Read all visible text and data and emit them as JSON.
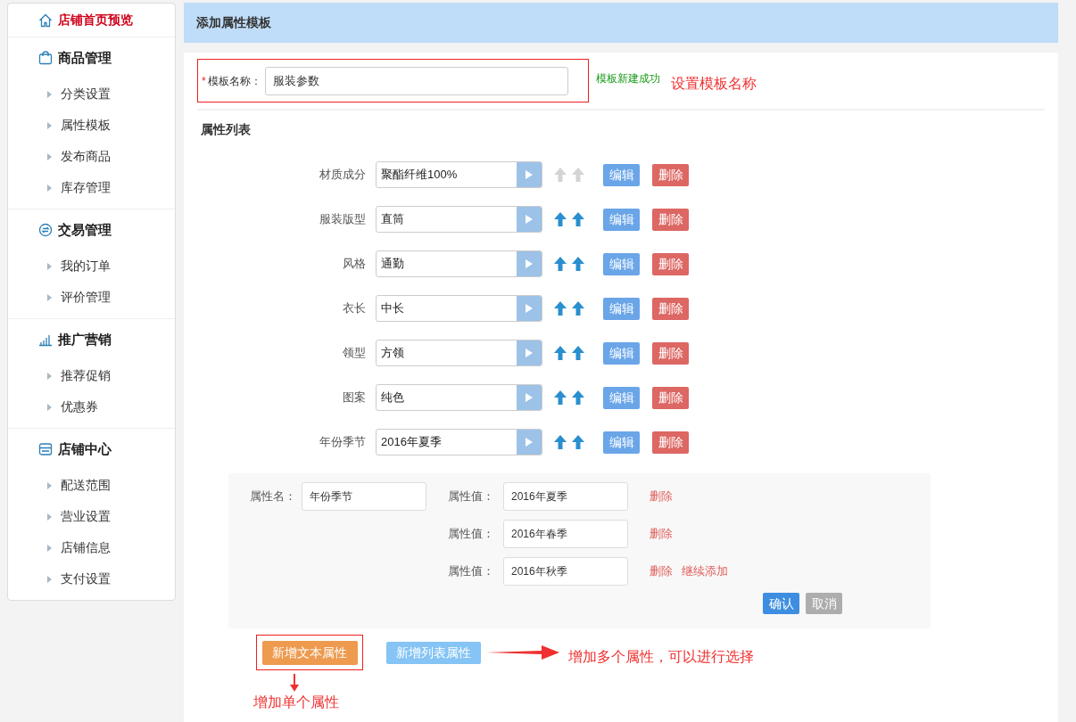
{
  "sidebar": {
    "home": {
      "label": "店铺首页预览",
      "selected": true
    },
    "groups": [
      {
        "kind": "bag",
        "title": "商品管理",
        "items": [
          "分类设置",
          "属性模板",
          "发布商品",
          "库存管理"
        ]
      },
      {
        "kind": "exchange",
        "title": "交易管理",
        "items": [
          "我的订单",
          "评价管理"
        ]
      },
      {
        "kind": "chart",
        "title": "推广营销",
        "items": [
          "推荐促销",
          "优惠券"
        ]
      },
      {
        "kind": "store",
        "title": "店铺中心",
        "items": [
          "配送范围",
          "营业设置",
          "店铺信息",
          "支付设置"
        ]
      }
    ]
  },
  "page_title": "添加属性模板",
  "template_name": {
    "required_mark": "*",
    "label": "模板名称：",
    "value": "服装参数",
    "status": "模板新建成功",
    "annotation": "设置模板名称"
  },
  "list_title": "属性列表",
  "attributes": [
    {
      "label": "材质成分",
      "value": "聚酯纤维100%",
      "movable": false,
      "edit": "编辑",
      "delete": "删除"
    },
    {
      "label": "服装版型",
      "value": "直筒",
      "movable": true,
      "edit": "编辑",
      "delete": "删除"
    },
    {
      "label": "风格",
      "value": "通勤",
      "movable": true,
      "edit": "编辑",
      "delete": "删除"
    },
    {
      "label": "衣长",
      "value": "中长",
      "movable": true,
      "edit": "编辑",
      "delete": "删除"
    },
    {
      "label": "领型",
      "value": "方领",
      "movable": true,
      "edit": "编辑",
      "delete": "删除"
    },
    {
      "label": "图案",
      "value": "纯色",
      "movable": true,
      "edit": "编辑",
      "delete": "删除"
    },
    {
      "label": "年份季节",
      "value": "2016年夏季",
      "movable": true,
      "edit": "编辑",
      "delete": "删除"
    }
  ],
  "editor": {
    "name_label": "属性名：",
    "name_value": "年份季节",
    "values": [
      {
        "label": "属性值：",
        "value": "2016年夏季",
        "links": [
          "删除"
        ]
      },
      {
        "label": "属性值：",
        "value": "2016年春季",
        "links": [
          "删除"
        ]
      },
      {
        "label": "属性值：",
        "value": "2016年秋季",
        "links": [
          "删除",
          "继续添加"
        ]
      }
    ],
    "confirm": "确认",
    "cancel": "取消"
  },
  "add_text_button": "新增文本属性",
  "add_list_button": "新增列表属性",
  "annotations": {
    "single": "增加单个属性",
    "multiple": "增加多个属性，可以进行选择"
  }
}
